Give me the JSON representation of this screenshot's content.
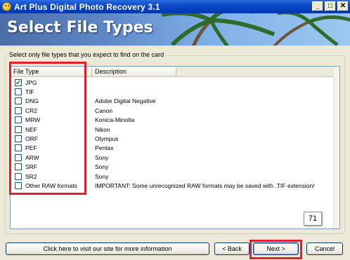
{
  "window": {
    "title": "Art Plus Digital Photo Recovery 3.1",
    "controls": [
      "_",
      "□",
      "✕"
    ]
  },
  "banner": {
    "heading": "Select File Types"
  },
  "group": {
    "legend": "Select only file types that you expect to find on the card"
  },
  "list": {
    "columns": [
      "File Type",
      "Description"
    ],
    "rows": [
      {
        "type": "JPG",
        "desc": "",
        "checked": true
      },
      {
        "type": "TIF",
        "desc": "",
        "checked": false
      },
      {
        "type": "DNG",
        "desc": "Adobe Digital Negative",
        "checked": false
      },
      {
        "type": "CR2",
        "desc": "Canon",
        "checked": false
      },
      {
        "type": "MRW",
        "desc": "Konica-Minolta",
        "checked": false
      },
      {
        "type": "NEF",
        "desc": "Nikon",
        "checked": false
      },
      {
        "type": "ORF",
        "desc": "Olympus",
        "checked": false
      },
      {
        "type": "PEF",
        "desc": "Pentax",
        "checked": false
      },
      {
        "type": "ARW",
        "desc": "Sony",
        "checked": false
      },
      {
        "type": "SRF",
        "desc": "Sony",
        "checked": false
      },
      {
        "type": "SR2",
        "desc": "Sony",
        "checked": false
      },
      {
        "type": "Other RAW formats",
        "desc": "IMPORTANT: Some unrecognized RAW formats may be saved with .TIF extension!",
        "checked": false
      }
    ]
  },
  "badge": {
    "value": "71"
  },
  "buttons": {
    "info": "Click here to visit our site for more information",
    "back": "< Back",
    "next": "Next >",
    "cancel": "Cancel"
  },
  "colors": {
    "highlight": "#e0202a",
    "titlebar": "#0a46c8"
  }
}
